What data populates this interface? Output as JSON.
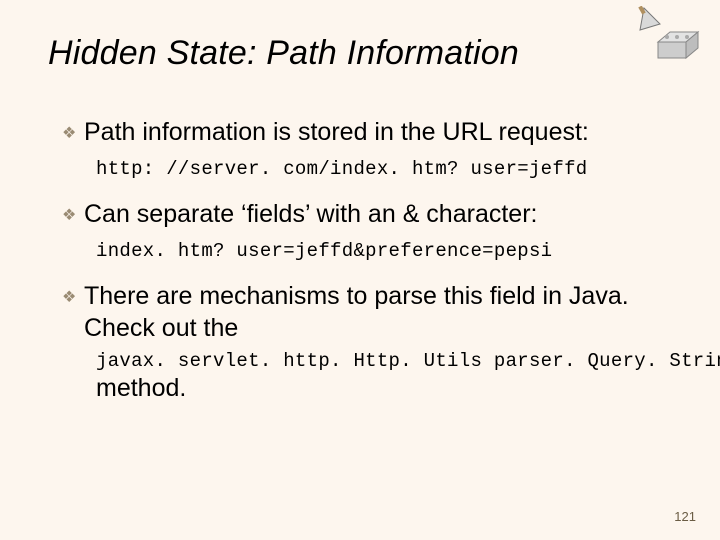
{
  "title": "Hidden State: Path Information",
  "bullets": [
    {
      "text": "Path information is stored in the URL request:",
      "code": "http: //server. com/index. htm? user=jeffd"
    },
    {
      "text": "Can separate ‘fields’ with an & character:",
      "code": "index. htm? user=jeffd&preference=pepsi"
    },
    {
      "text": "There are mechanisms to parse this field in Java.  Check out the",
      "code": "javax. servlet. http. Http. Utils parser. Query. String()",
      "trailing": "method."
    }
  ],
  "page_number": "121",
  "bullet_glyph": "❖"
}
